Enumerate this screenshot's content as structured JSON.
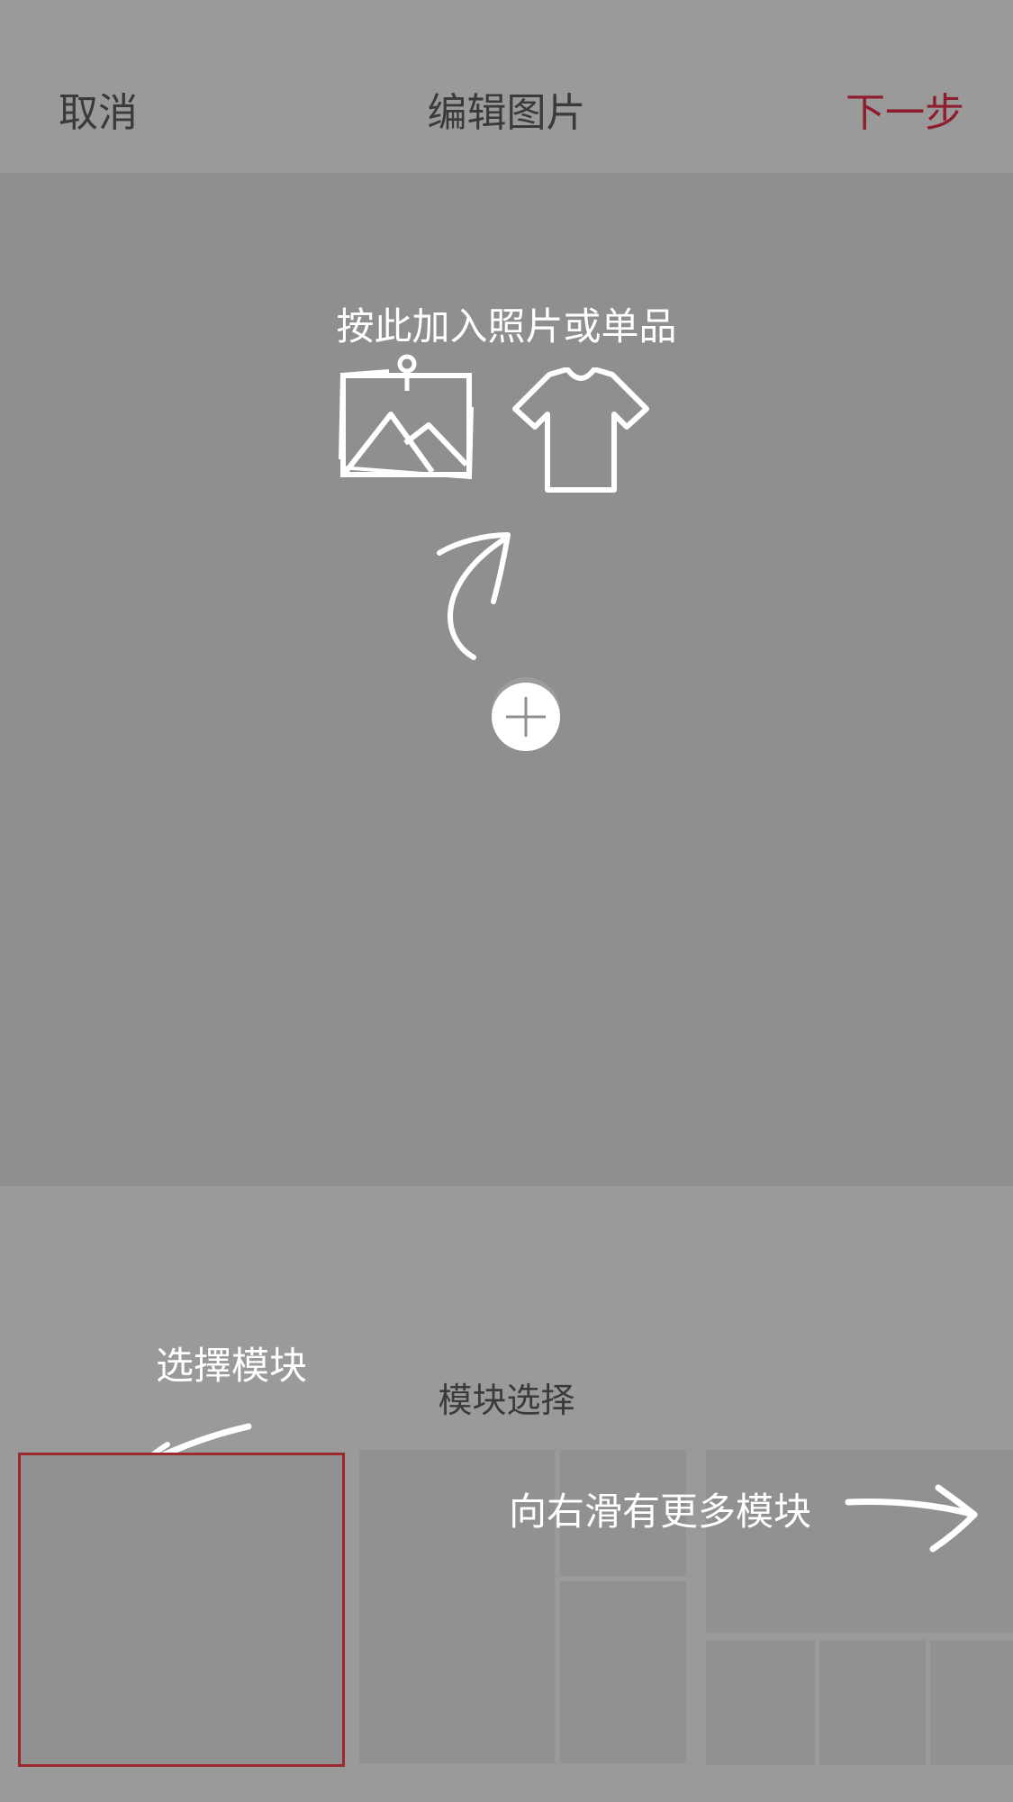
{
  "nav": {
    "cancel": "取消",
    "title": "编辑图片",
    "next": "下一步"
  },
  "canvas": {
    "add_hint": "按此加入照片或单品",
    "icons": [
      "photo-icon",
      "tshirt-icon",
      "curved-arrow-icon",
      "plus-icon"
    ]
  },
  "modules": {
    "select_hint": "选擇模块",
    "title": "模块选择",
    "swipe_hint": "向右滑有更多模块"
  },
  "colors": {
    "accent": "#8e1e2e",
    "selected_border": "#9a2a2f",
    "overlay": "#999999"
  }
}
